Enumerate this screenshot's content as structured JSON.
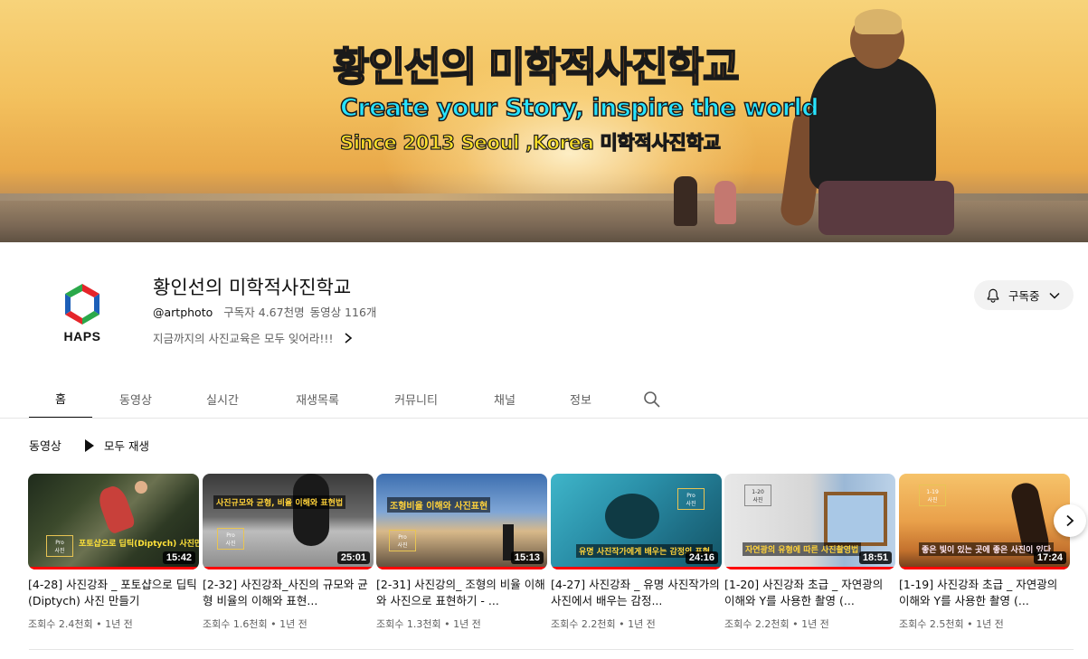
{
  "banner": {
    "title": "황인선의 미학적사진학교",
    "subtitle1": "Create your Story, inspire the world",
    "subtitle2": "Since 2013  Seoul ,Korea 미학적사진학교"
  },
  "channel": {
    "logo_text": "HAPS",
    "name": "황인선의 미학적사진학교",
    "handle": "@artphoto",
    "subscribers": "구독자 4.67천명",
    "video_count": "동영상 116개",
    "description": "지금까지의 사진교육은 모두 잊어라!!!",
    "subscribe_label": "구독중"
  },
  "tabs": [
    {
      "label": "홈",
      "active": true
    },
    {
      "label": "동영상",
      "active": false
    },
    {
      "label": "실시간",
      "active": false
    },
    {
      "label": "재생목록",
      "active": false
    },
    {
      "label": "커뮤니티",
      "active": false
    },
    {
      "label": "채널",
      "active": false
    },
    {
      "label": "정보",
      "active": false
    }
  ],
  "section": {
    "title": "동영상",
    "play_all": "모두 재생"
  },
  "videos": [
    {
      "title": "[4-28] 사진강좌 _ 포토샵으로 딥틱 (Diptych) 사진 만들기",
      "duration": "15:42",
      "meta": "조회수 2.4천회 • 1년 전",
      "thumb_text": "포토샵으로 딥틱(Diptych) 사진만들기"
    },
    {
      "title": "[2-32] 사진강좌_사진의 규모와 균형 비율의 이해와 표현...",
      "duration": "25:01",
      "meta": "조회수 1.6천회 • 1년 전",
      "thumb_text": "사진규모와 균형, 비율 이해와 표현법"
    },
    {
      "title": "[2-31] 사진강의_ 조형의 비율 이해와 사진으로 표현하기 - ...",
      "duration": "15:13",
      "meta": "조회수 1.3천회 • 1년 전",
      "thumb_text": "조형비율 이해와 사진표현"
    },
    {
      "title": "[4-27] 사진강좌 _ 유명 사진작가의 사진에서 배우는 감정...",
      "duration": "24:16",
      "meta": "조회수 2.2천회 • 1년 전",
      "thumb_text": "유명 사진작가에게 배우는 감정의 표현"
    },
    {
      "title": "[1-20] 사진강좌 초급 _ 자연광의 이해와 Y를 사용한 촬영 (...",
      "duration": "18:51",
      "meta": "조회수 2.2천회 • 1년 전",
      "thumb_text": "자연광의 유형에 따른 사진촬영법"
    },
    {
      "title": "[1-19] 사진강좌 초급 _ 자연광의 이해와 Y를 사용한 촬영 (...",
      "duration": "17:24",
      "meta": "조회수 2.5천회 • 1년 전",
      "thumb_text": "좋은 빛이 있는 곳에 좋은 사진이 있다"
    }
  ],
  "icons": {
    "bell": "bell-icon",
    "chevron_down": "chevron-down-icon",
    "chevron_right": "chevron-right-icon",
    "search": "search-icon",
    "play": "play-icon"
  },
  "colors": {
    "progress": "#ff0000",
    "logo_red": "#e5252a",
    "logo_blue": "#1c5fb8",
    "logo_green": "#2aa84a"
  }
}
